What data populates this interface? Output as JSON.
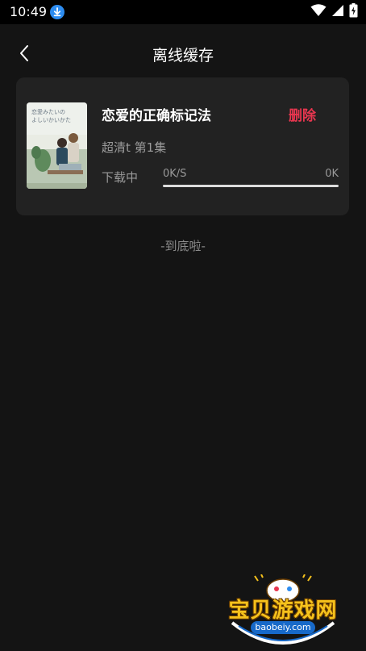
{
  "status_bar": {
    "time": "10:49",
    "download_icon": "download-icon",
    "wifi_icon": "wifi-icon",
    "signal_icon": "signal-icon",
    "battery_icon": "battery-charging-icon"
  },
  "header": {
    "back_icon": "chevron-left-icon",
    "title": "离线缓存"
  },
  "item": {
    "title": "恋爱的正确标记法",
    "delete_label": "删除",
    "quality_episode": "超清t  第1集",
    "status": "下载中",
    "speed": "0K/S",
    "size": "0K",
    "progress": 0,
    "cover_caption": "恋愛みたいの\nよしいかいかた"
  },
  "footer": {
    "end_text": "-到底啦-"
  },
  "watermark": {
    "brand": "宝贝游戏网",
    "url": "baobeiy.com"
  },
  "colors": {
    "background": "#141414",
    "card": "#222222",
    "accent": "#e8364f",
    "muted_text": "#9a9a9a"
  }
}
